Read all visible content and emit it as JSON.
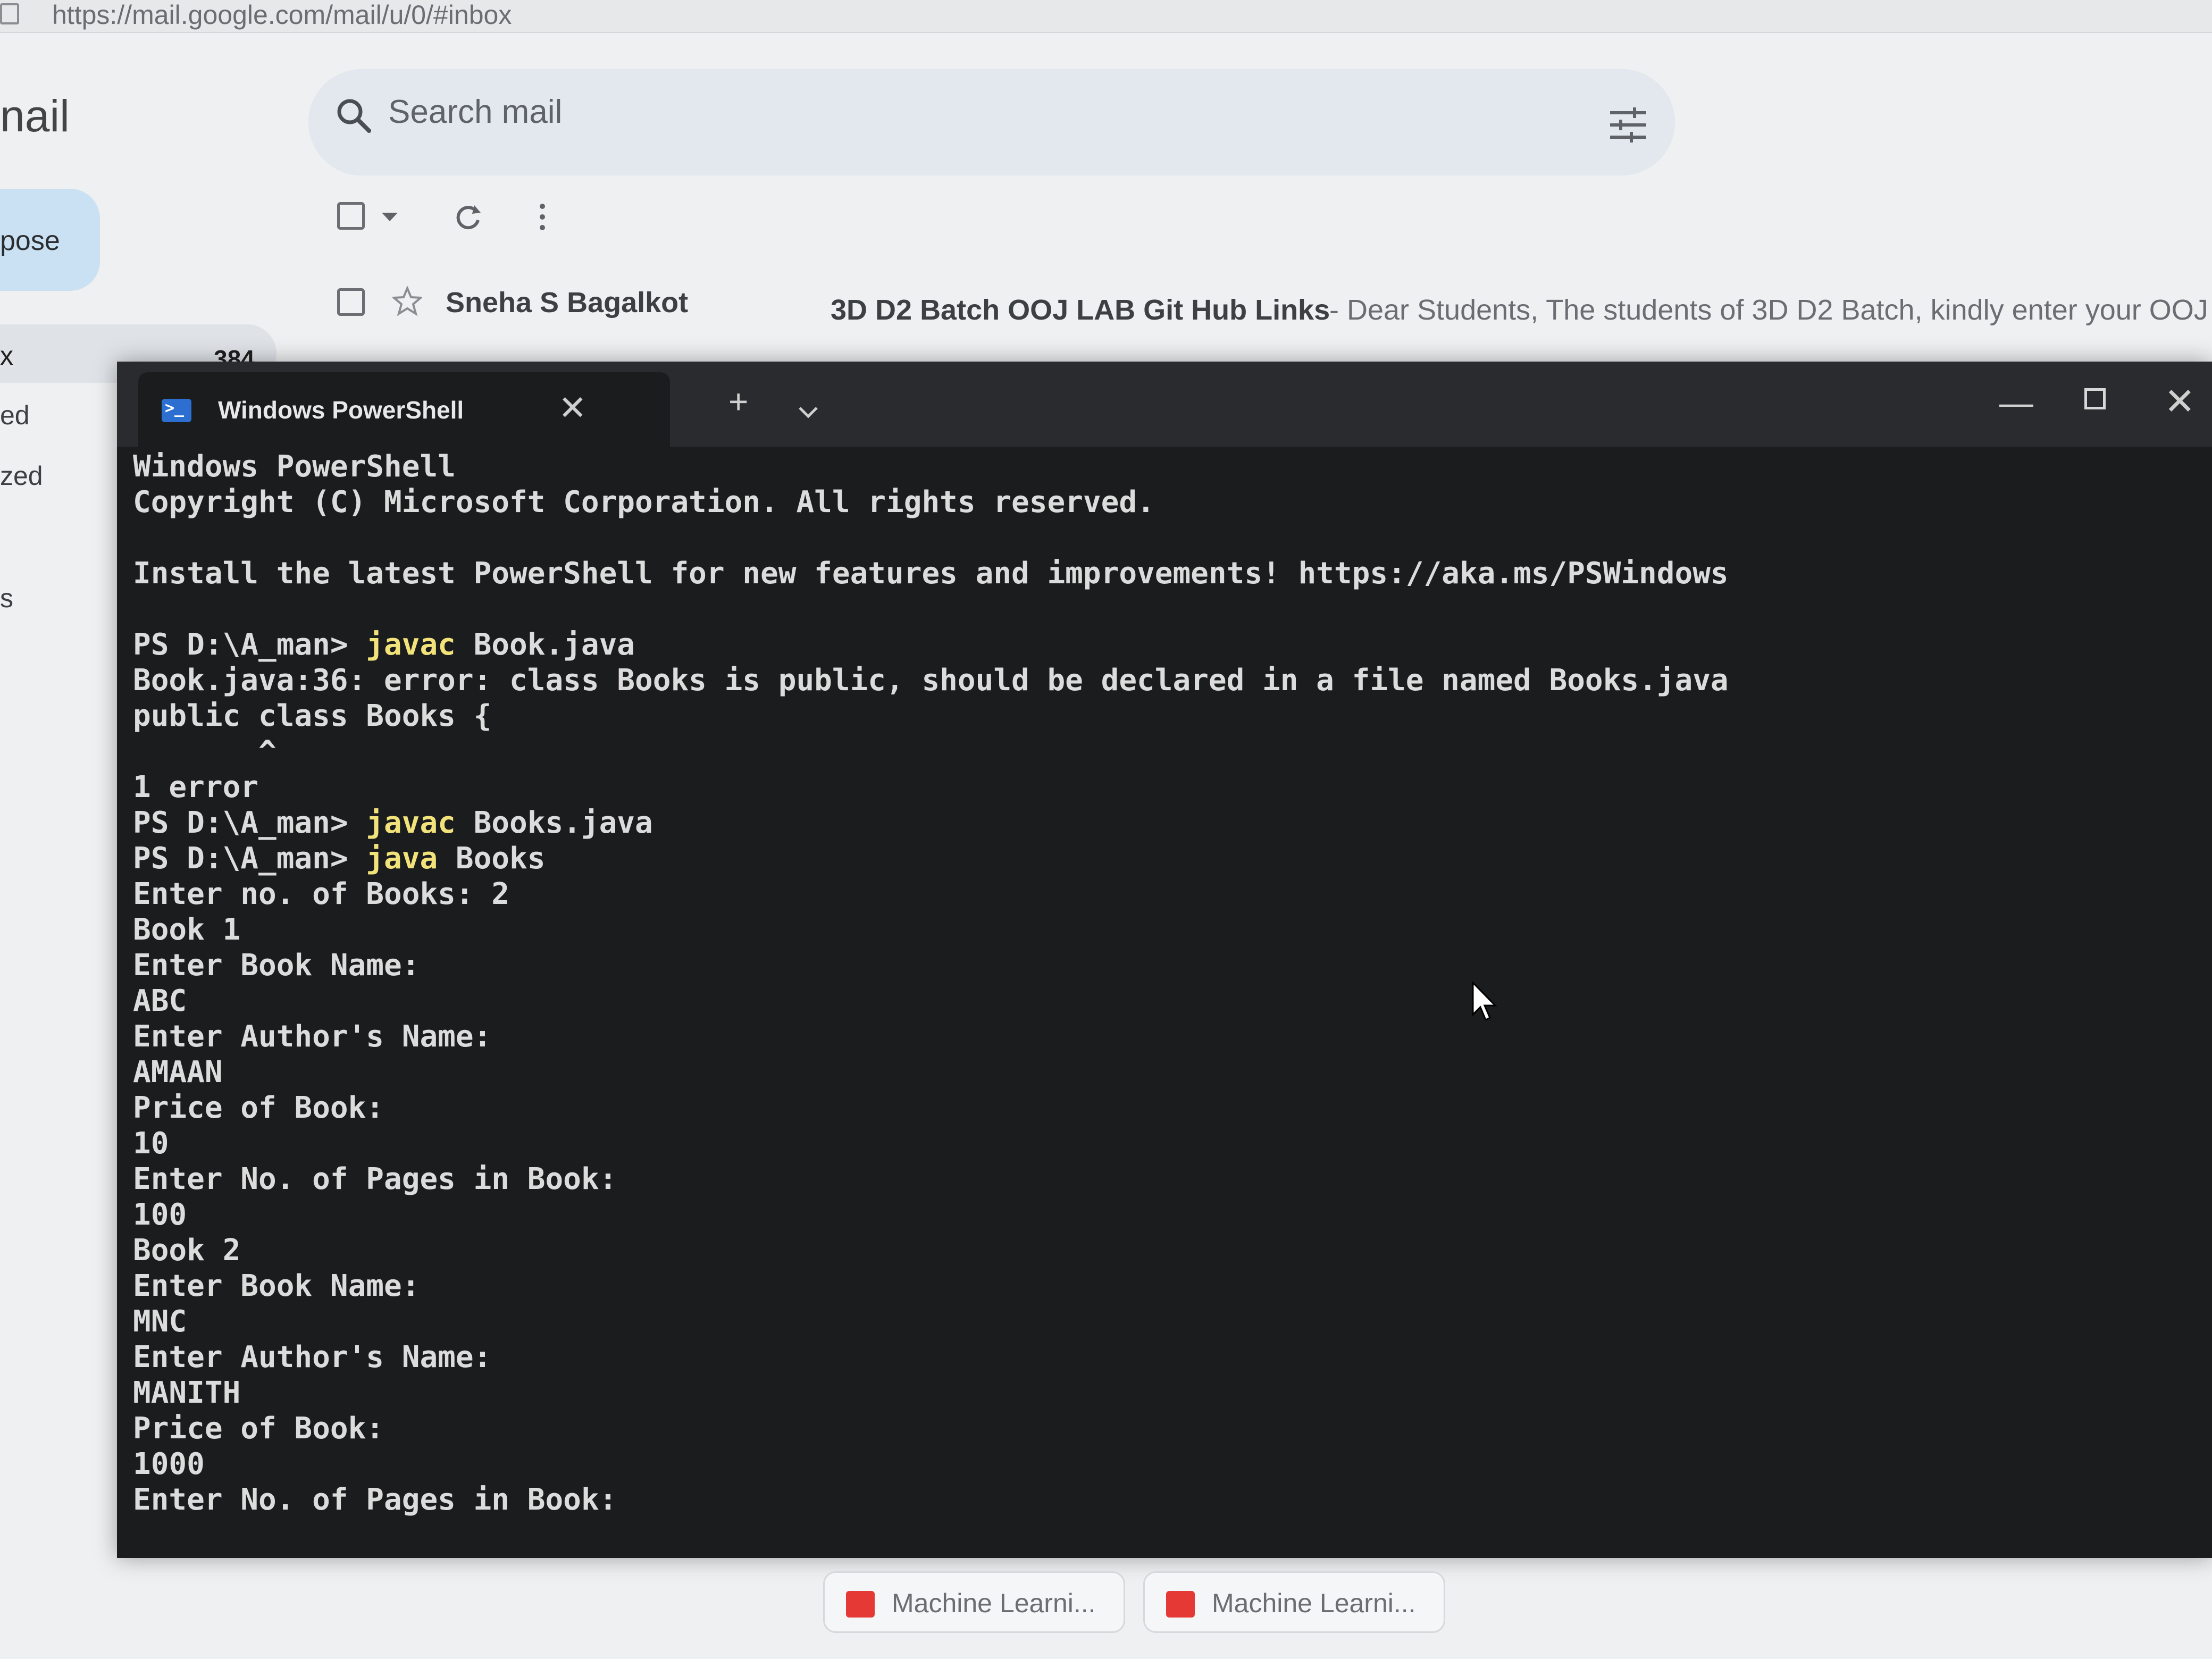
{
  "browser": {
    "url": "https://mail.google.com/mail/u/0/#inbox"
  },
  "gmail": {
    "brand": "nail",
    "compose_label": "pose",
    "nav": {
      "inbox_label": "x",
      "inbox_count": "384",
      "items": [
        "ed",
        "zed",
        "s"
      ]
    },
    "search": {
      "placeholder": "Search mail"
    },
    "email": {
      "sender": "Sneha S Bagalkot",
      "subject": "3D D2 Batch OOJ LAB Git Hub Links",
      "snippet": "- Dear Students, The students of 3D D2 Batch, kindly enter your OOJ LAB Git"
    }
  },
  "powershell": {
    "tab_title": "Windows PowerShell",
    "lines": [
      {
        "text": "Windows PowerShell"
      },
      {
        "text": "Copyright (C) Microsoft Corporation. All rights reserved."
      },
      {
        "text": ""
      },
      {
        "text": "Install the latest PowerShell for new features and improvements! https://aka.ms/PSWindows"
      },
      {
        "text": ""
      },
      {
        "prompt": "PS D:\\A_man> ",
        "cmd": "javac",
        "args": " Book.java"
      },
      {
        "text": "Book.java:36: error: class Books is public, should be declared in a file named Books.java"
      },
      {
        "text": "public class Books {"
      },
      {
        "text": "       ^"
      },
      {
        "text": "1 error"
      },
      {
        "prompt": "PS D:\\A_man> ",
        "cmd": "javac",
        "args": " Books.java"
      },
      {
        "prompt": "PS D:\\A_man> ",
        "cmd": "java",
        "args": " Books"
      },
      {
        "text": "Enter no. of Books: 2"
      },
      {
        "text": "Book 1"
      },
      {
        "text": "Enter Book Name:"
      },
      {
        "text": "ABC"
      },
      {
        "text": "Enter Author's Name:"
      },
      {
        "text": "AMAAN"
      },
      {
        "text": "Price of Book:"
      },
      {
        "text": "10"
      },
      {
        "text": "Enter No. of Pages in Book:"
      },
      {
        "text": "100"
      },
      {
        "text": "Book 2"
      },
      {
        "text": "Enter Book Name:"
      },
      {
        "text": "MNC"
      },
      {
        "text": "Enter Author's Name:"
      },
      {
        "text": "MANITH"
      },
      {
        "text": "Price of Book:"
      },
      {
        "text": "1000"
      },
      {
        "text": "Enter No. of Pages in Book:"
      }
    ]
  },
  "taskbar": {
    "items": [
      "Machine Learni...",
      "Machine Learni..."
    ]
  },
  "colors": {
    "terminal_bg": "#1b1c1e",
    "terminal_text": "#dcdcdc",
    "command_highlight": "#f1e27a",
    "powershell_icon": "#2c6fd1",
    "pdf_icon": "#e53935"
  }
}
